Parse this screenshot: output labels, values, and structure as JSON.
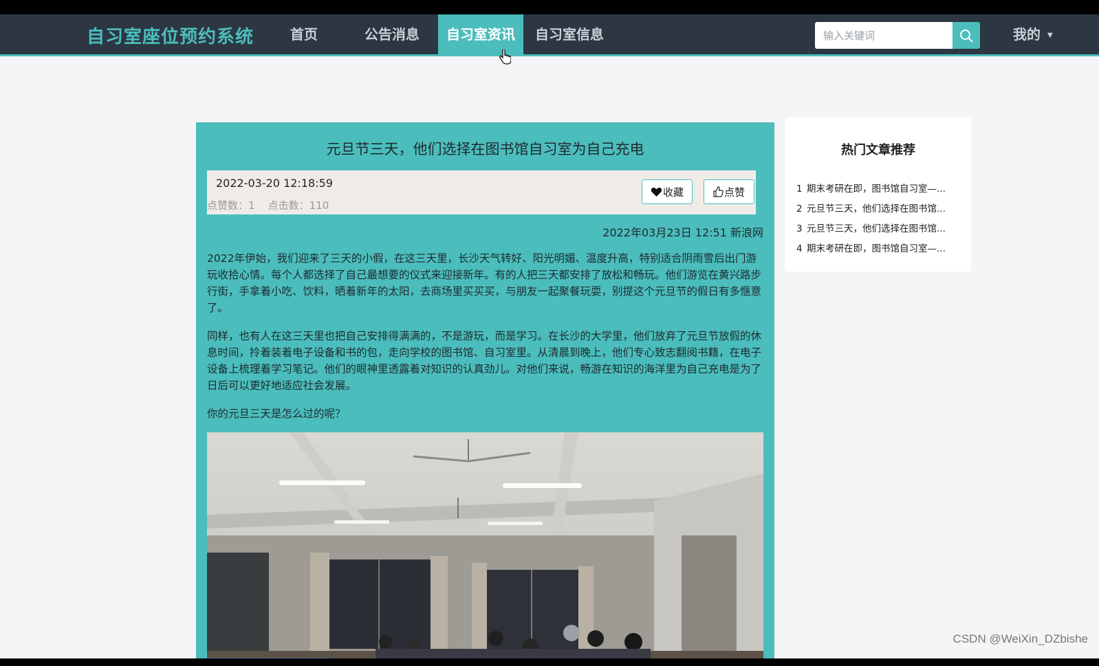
{
  "nav": {
    "brand": "自习室座位预约系统",
    "items": [
      "首页",
      "公告消息",
      "自习室资讯",
      "自习室信息"
    ],
    "active_index": 2,
    "search_placeholder": "输入关键词",
    "mine_label": "我的"
  },
  "article": {
    "title": "元旦节三天，他们选择在图书馆自习室为自己充电",
    "date": "2022-03-20 12:18:59",
    "likes_text": "点赞数：1",
    "clicks_text": "点击数：110",
    "favorite_label": "收藏",
    "like_label": "点赞",
    "source": "2022年03月23日 12:51 新浪网",
    "paragraphs": [
      "2022年伊始，我们迎来了三天的小假，在这三天里，长沙天气转好、阳光明媚、温度升高，特别适合阴雨雪后出门游玩收拾心情。每个人都选择了自己最想要的仪式来迎接新年。有的人把三天都安排了放松和畅玩。他们游览在黄兴路步行街，手拿着小吃、饮料，晒着新年的太阳，去商场里买买买，与朋友一起聚餐玩耍，别提这个元旦节的假日有多惬意了。",
      "同样，也有人在这三天里也把自己安排得满满的，不是游玩，而是学习。在长沙的大学里，他们放弃了元旦节放假的休息时间，拎着装着电子设备和书的包，走向学校的图书馆、自习室里。从清晨到晚上，他们专心致志翻阅书籍，在电子设备上梳理着学习笔记。他们的眼神里透露着对知识的认真劲儿。对他们来说，畅游在知识的海洋里为自己充电是为了日后可以更好地适应社会发展。",
      "你的元旦三天是怎么过的呢？"
    ]
  },
  "sidebar": {
    "title": "热门文章推荐",
    "items": [
      {
        "num": "1",
        "text": "期末考研在即，图书馆自习室—..."
      },
      {
        "num": "2",
        "text": "元旦节三天，他们选择在图书馆..."
      },
      {
        "num": "3",
        "text": "元旦节三天，他们选择在图书馆..."
      },
      {
        "num": "4",
        "text": "期末考研在即，图书馆自习室—..."
      }
    ]
  },
  "watermark": "CSDN @WeiXin_DZbishe",
  "colors": {
    "accent": "#4bbdbc",
    "navbar": "#2c3743",
    "page_bg": "#f4f5f7"
  }
}
